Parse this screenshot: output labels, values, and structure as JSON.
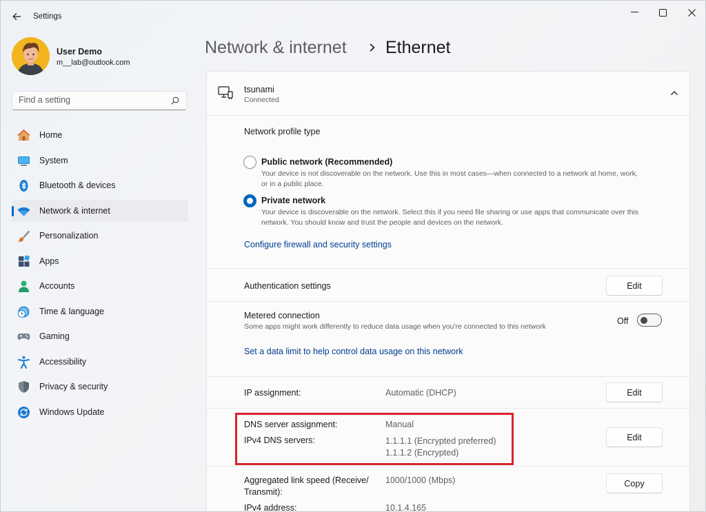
{
  "window": {
    "title": "Settings",
    "controls": [
      "minimize",
      "maximize",
      "close"
    ]
  },
  "user": {
    "name": "User Demo",
    "email": "m__lab@outlook.com"
  },
  "search": {
    "placeholder": "Find a setting"
  },
  "nav": {
    "items": [
      {
        "label": "Home",
        "icon": "home-icon"
      },
      {
        "label": "System",
        "icon": "system-icon"
      },
      {
        "label": "Bluetooth & devices",
        "icon": "bluetooth-icon"
      },
      {
        "label": "Network & internet",
        "icon": "wifi-icon",
        "active": true
      },
      {
        "label": "Personalization",
        "icon": "brush-icon"
      },
      {
        "label": "Apps",
        "icon": "apps-icon"
      },
      {
        "label": "Accounts",
        "icon": "accounts-icon"
      },
      {
        "label": "Time & language",
        "icon": "clock-icon"
      },
      {
        "label": "Gaming",
        "icon": "gamepad-icon"
      },
      {
        "label": "Accessibility",
        "icon": "accessibility-icon"
      },
      {
        "label": "Privacy & security",
        "icon": "shield-icon"
      },
      {
        "label": "Windows Update",
        "icon": "update-icon"
      }
    ]
  },
  "breadcrumb": {
    "parent": "Network & internet",
    "current": "Ethernet"
  },
  "connection": {
    "name": "tsunami",
    "status": "Connected"
  },
  "profile": {
    "heading": "Network profile type",
    "public_title": "Public network (Recommended)",
    "public_desc_1": "Your device is not discoverable on the network. Use this in most cases—when connected to a network at home, work,",
    "public_desc_2": "or in a public place.",
    "private_title": "Private network",
    "private_desc_1": "Your device is discoverable on the network. Select this if you need file sharing or use apps that communicate over this",
    "private_desc_2": "network. You should know and trust the people and devices on the network.",
    "selected": "private",
    "firewall_link": "Configure firewall and security settings"
  },
  "auth": {
    "label": "Authentication settings",
    "button": "Edit"
  },
  "metered": {
    "label": "Metered connection",
    "desc": "Some apps might work differently to reduce data usage when you're connected to this network",
    "state": "Off",
    "data_limit_link": "Set a data limit to help control data usage on this network"
  },
  "ip": {
    "label": "IP assignment:",
    "value": "Automatic (DHCP)",
    "button": "Edit"
  },
  "dns": {
    "assignment_label": "DNS server assignment:",
    "assignment_value": "Manual",
    "servers_label": "IPv4 DNS servers:",
    "server_1": "1.1.1.1 (Encrypted preferred)",
    "server_2": "1.1.1.2 (Encrypted)",
    "button": "Edit",
    "highlight_color": "#d8232a"
  },
  "properties": {
    "speed_label_1": "Aggregated link speed (Receive/",
    "speed_label_2": "Transmit):",
    "speed_value": "1000/1000 (Mbps)",
    "ipv4_label": "IPv4 address:",
    "ipv4_value": "10.1.4.165",
    "button": "Copy"
  },
  "colors": {
    "accent": "#0067c0",
    "link": "#003e92"
  }
}
